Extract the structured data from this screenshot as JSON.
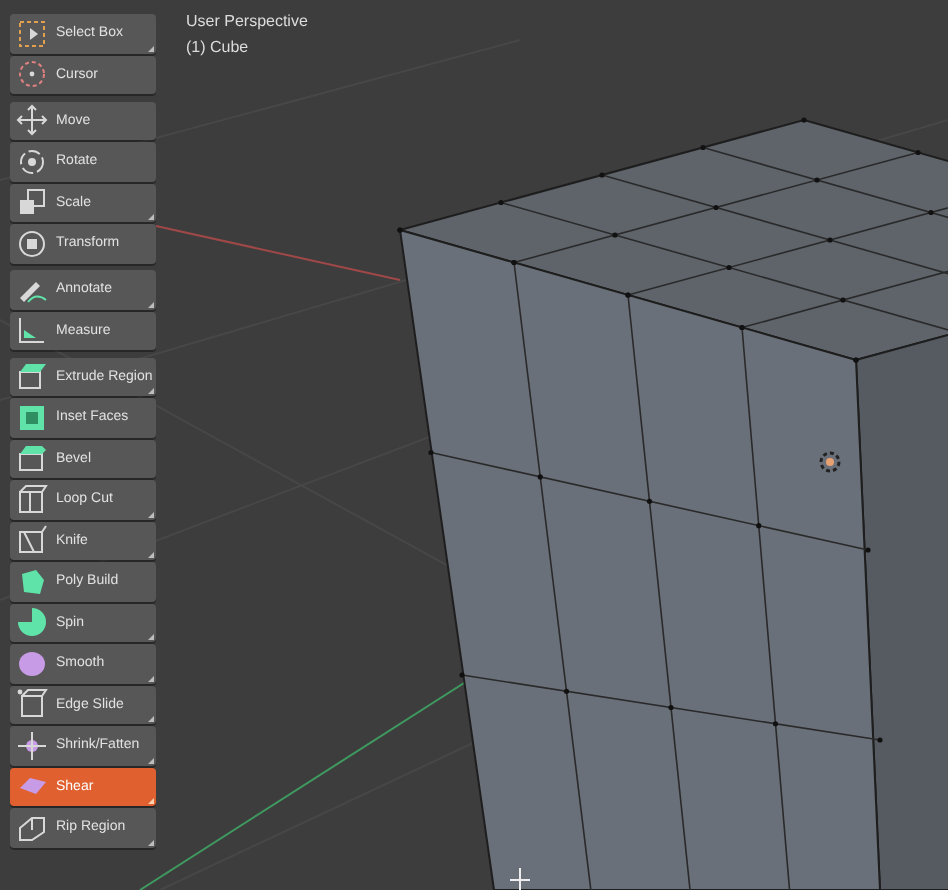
{
  "viewport": {
    "view_name": "User Perspective",
    "object_label": "(1) Cube"
  },
  "toolbar": {
    "groups": [
      {
        "tools": [
          {
            "label": "Select Box",
            "submenu": true,
            "selected": false
          },
          {
            "label": "Cursor",
            "submenu": false,
            "selected": false
          }
        ]
      },
      {
        "tools": [
          {
            "label": "Move",
            "submenu": false,
            "selected": false
          },
          {
            "label": "Rotate",
            "submenu": false,
            "selected": false
          },
          {
            "label": "Scale",
            "submenu": true,
            "selected": false
          },
          {
            "label": "Transform",
            "submenu": false,
            "selected": false
          }
        ]
      },
      {
        "tools": [
          {
            "label": "Annotate",
            "submenu": true,
            "selected": false
          },
          {
            "label": "Measure",
            "submenu": false,
            "selected": false
          }
        ]
      },
      {
        "tools": [
          {
            "label": "Extrude Region",
            "submenu": true,
            "selected": false
          },
          {
            "label": "Inset Faces",
            "submenu": false,
            "selected": false
          },
          {
            "label": "Bevel",
            "submenu": false,
            "selected": false
          },
          {
            "label": "Loop Cut",
            "submenu": true,
            "selected": false
          },
          {
            "label": "Knife",
            "submenu": true,
            "selected": false
          },
          {
            "label": "Poly Build",
            "submenu": false,
            "selected": false
          },
          {
            "label": "Spin",
            "submenu": true,
            "selected": false
          },
          {
            "label": "Smooth",
            "submenu": true,
            "selected": false
          },
          {
            "label": "Edge Slide",
            "submenu": true,
            "selected": false
          },
          {
            "label": "Shrink/Fatten",
            "submenu": true,
            "selected": false
          },
          {
            "label": "Shear",
            "submenu": true,
            "selected": true
          },
          {
            "label": "Rip Region",
            "submenu": true,
            "selected": false
          }
        ]
      }
    ]
  }
}
